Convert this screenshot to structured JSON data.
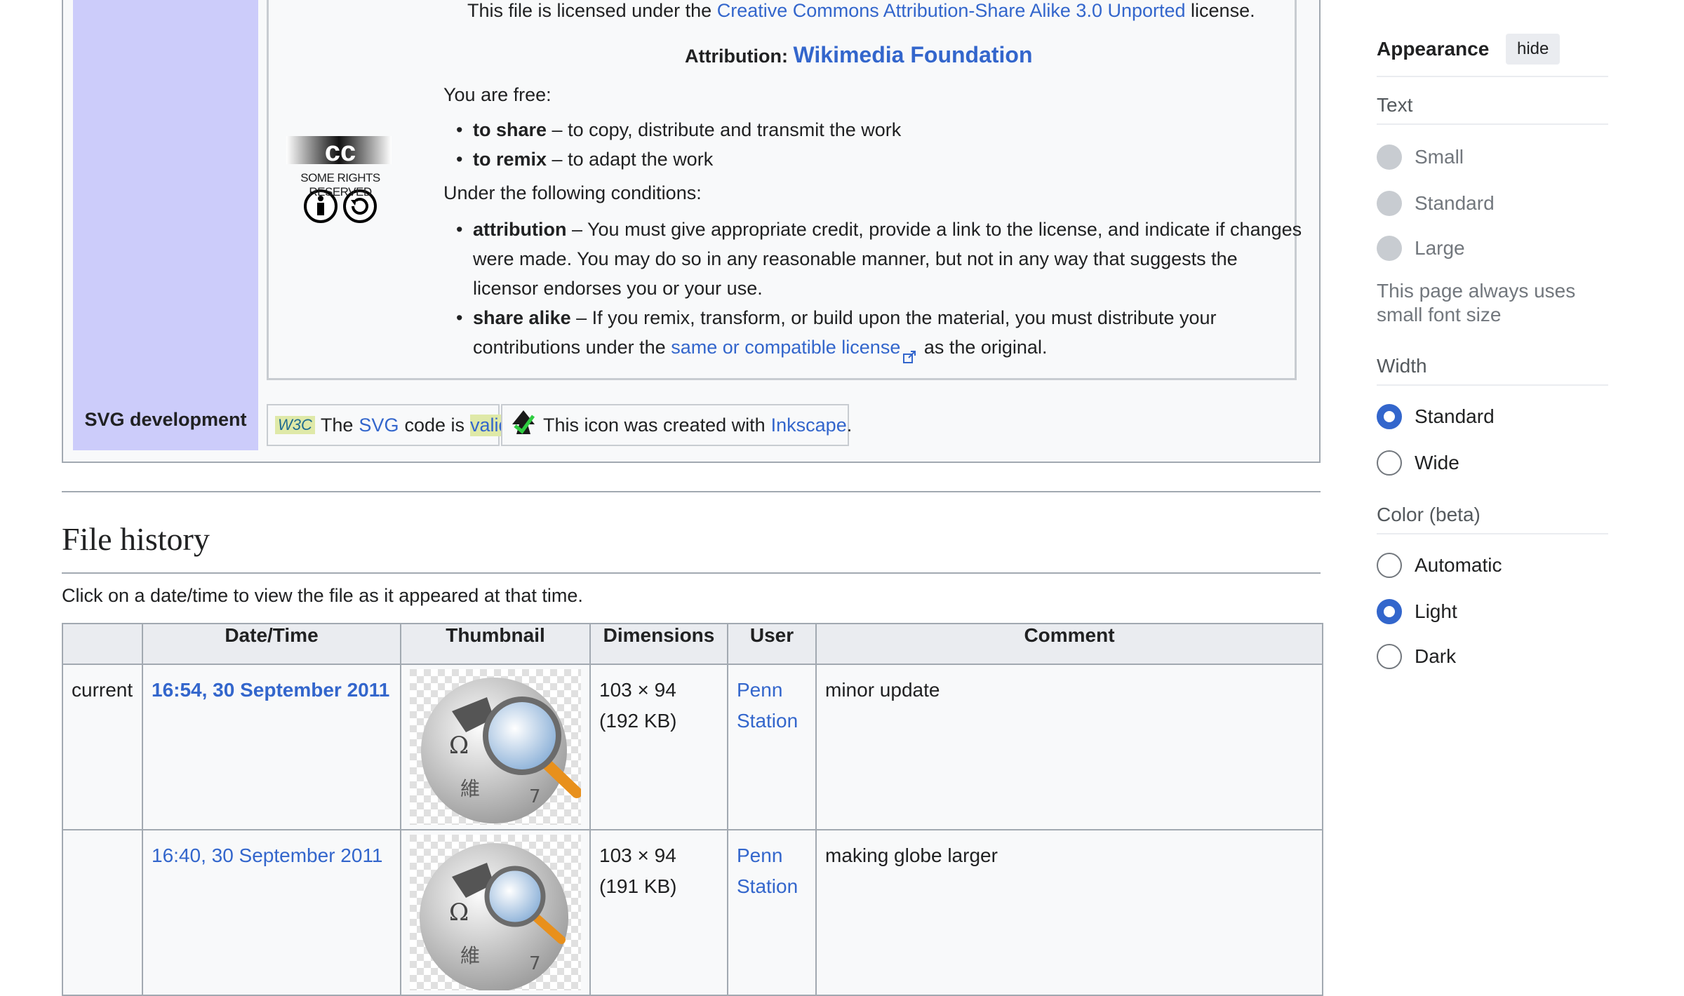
{
  "license": {
    "line1_prefix": "This file is licensed under the",
    "line1_link": "Creative Commons Attribution-Share Alike 3.0 Unported",
    "line1_suffix": "license.",
    "attribution_label": "Attribution:",
    "attribution_value": "Wikimedia Foundation",
    "badge_text": "SOME RIGHTS RESERVED",
    "free_heading": "You are free:",
    "free_items": [
      {
        "term": "to share",
        "desc": " – to copy, distribute and transmit the work"
      },
      {
        "term": "to remix",
        "desc": " – to adapt the work"
      }
    ],
    "conditions_heading": "Under the following conditions:",
    "attribution_term": "attribution",
    "attribution_desc": " – You must give appropriate credit, provide a link to the license, and indicate if changes were made. You may do so in any reasonable manner, but not in any way that suggests the licensor endorses you or your use.",
    "sharealike_term": "share alike",
    "sharealike_desc1": " – If you remix, transform, or build upon the material, you must distribute your contributions under the ",
    "sharealike_link": "same or compatible license",
    "sharealike_desc2": " as the original."
  },
  "svgdev": {
    "label": "SVG development",
    "w3c_text_prefix": "The",
    "w3c_svg_link": "SVG",
    "w3c_mid": "code is",
    "w3c_valid_link": "valid",
    "w3c_end": ".",
    "inkscape_prefix": "This icon was created with",
    "inkscape_link": "Inkscape",
    "inkscape_end": "."
  },
  "history": {
    "heading": "File history",
    "intro": "Click on a date/time to view the file as it appeared at that time.",
    "columns": [
      "",
      "Date/Time",
      "Thumbnail",
      "Dimensions",
      "User",
      "Comment"
    ],
    "rows": [
      {
        "status": "current",
        "datetime": "16:54, 30 September 2011",
        "dims": "103 × 94",
        "size": "(192 KB)",
        "user1": "Penn",
        "user2": "Station",
        "comment": "minor update"
      },
      {
        "status": "",
        "datetime": "16:40, 30 September 2011",
        "dims": "103 × 94",
        "size": "(191 KB)",
        "user1": "Penn",
        "user2": "Station",
        "comment": "making globe larger"
      }
    ]
  },
  "appearance": {
    "title": "Appearance",
    "hide": "hide",
    "text_label": "Text",
    "text_options": [
      "Small",
      "Standard",
      "Large"
    ],
    "text_note": "This page always uses small font size",
    "width_label": "Width",
    "width_options": [
      "Standard",
      "Wide"
    ],
    "width_selected": "Standard",
    "color_label": "Color (beta)",
    "color_options": [
      "Automatic",
      "Light",
      "Dark"
    ],
    "color_selected": "Light"
  }
}
